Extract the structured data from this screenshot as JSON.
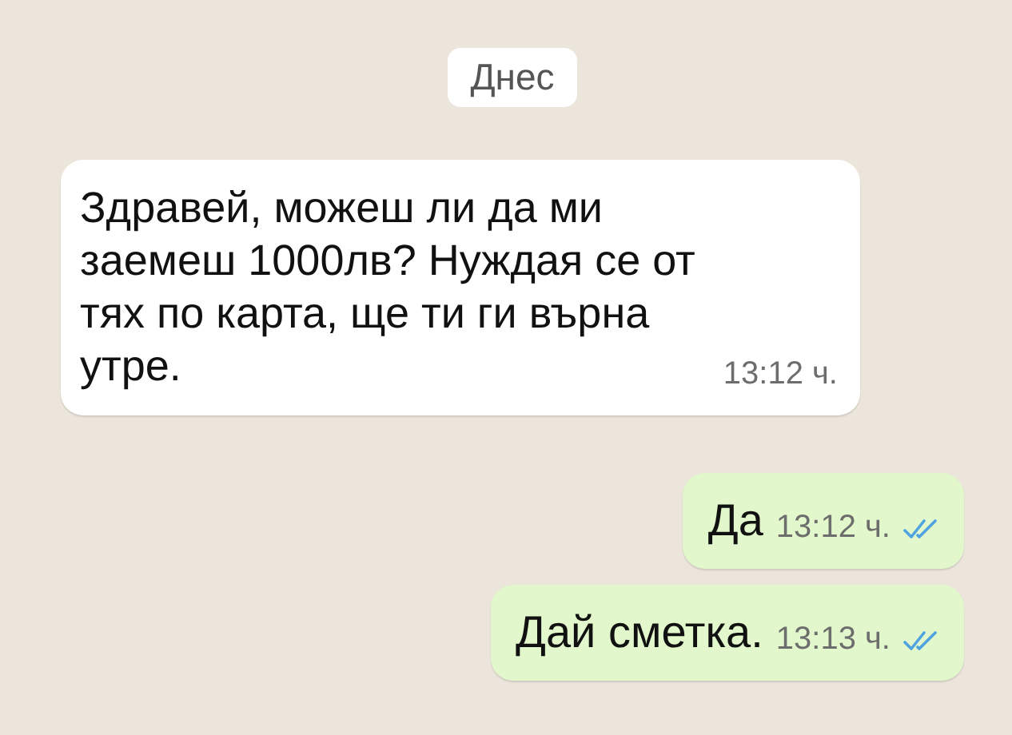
{
  "date_badge": "Днес",
  "messages": [
    {
      "kind": "incoming",
      "text": "Здравей, можеш ли да ми заемеш 1000лв? Нуждая се от тях по карта, ще ти ги върна утре.",
      "time": "13:12 ч."
    },
    {
      "kind": "outgoing",
      "text": "Да",
      "time": "13:12 ч.",
      "read": true
    },
    {
      "kind": "outgoing",
      "text": "Дай сметка.",
      "time": "13:13 ч.",
      "read": true
    }
  ]
}
